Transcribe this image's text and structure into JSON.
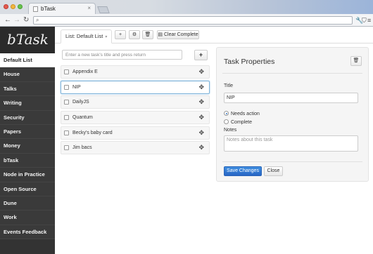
{
  "browser": {
    "tab_title": "bTask",
    "tab_close": "×",
    "back_icon": "←",
    "forward_icon": "→",
    "reload_icon": "↻",
    "search_icon": "⌕",
    "address": "",
    "wrench_icon": "🔧",
    "shield_icon": "⛉",
    "menu_icon": "≡"
  },
  "sidebar": {
    "logo": "bTask",
    "items": [
      {
        "label": "Default List",
        "active": true
      },
      {
        "label": "House"
      },
      {
        "label": "Talks"
      },
      {
        "label": "Writing"
      },
      {
        "label": "Security"
      },
      {
        "label": "Papers"
      },
      {
        "label": "Money"
      },
      {
        "label": "bTask"
      },
      {
        "label": "Node in Practice"
      },
      {
        "label": "Open Source"
      },
      {
        "label": "Dune"
      },
      {
        "label": "Work"
      },
      {
        "label": "Events Feedback"
      }
    ]
  },
  "toolbar": {
    "list_label": "List: Default List",
    "list_caret": "▾",
    "add_icon": "+",
    "gear_icon": "⚙",
    "trash_icon": "🗑",
    "clear_label": "Clear Complete",
    "clear_icon": "▤"
  },
  "new_task": {
    "placeholder": "Enter a new task's title and press return",
    "add_icon": "+"
  },
  "tasks": [
    {
      "title": "Appendix E"
    },
    {
      "title": "NIP",
      "selected": true
    },
    {
      "title": "DailyJS"
    },
    {
      "title": "Quantum"
    },
    {
      "title": "Becky's baby card"
    },
    {
      "title": "Jim bacs"
    }
  ],
  "move_icon": "✥",
  "properties": {
    "heading": "Task Properties",
    "delete_icon": "🗑",
    "title_label": "Title",
    "title_value": "NIP",
    "status_needs_action": "Needs action",
    "status_complete": "Complete",
    "notes_label": "Notes",
    "notes_placeholder": "Notes about this task",
    "save_label": "Save Changes",
    "close_label": "Close"
  },
  "colors": {
    "sidebar_bg": "#333333",
    "primary": "#2f7ad6"
  }
}
